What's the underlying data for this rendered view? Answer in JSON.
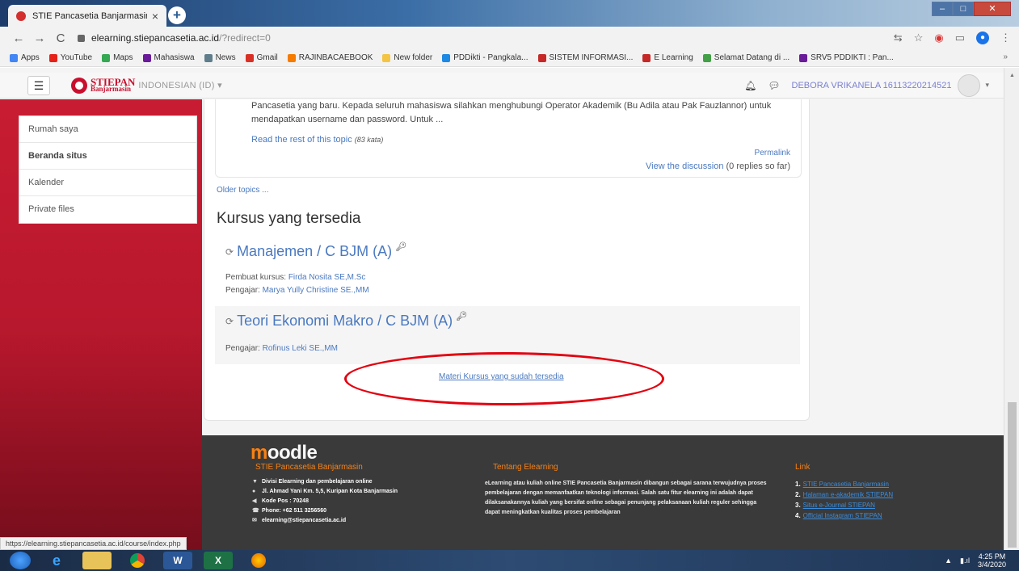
{
  "browser": {
    "tab_title": "STIE Pancasetia Banjarmasin",
    "tab_close": "×",
    "new_tab": "+",
    "url_host": "elearning.stiepancasetia.ac.id",
    "url_path": "/?redirect=0",
    "back": "←",
    "forward": "→",
    "reload": "C",
    "bookmarks": [
      {
        "label": "Apps",
        "color": "#4285f4"
      },
      {
        "label": "YouTube",
        "color": "#e62117"
      },
      {
        "label": "Maps",
        "color": "#34a853"
      },
      {
        "label": "Mahasiswa",
        "color": "#6a1b9a"
      },
      {
        "label": "News",
        "color": "#607d8b"
      },
      {
        "label": "Gmail",
        "color": "#d93025"
      },
      {
        "label": "RAJINBACAEBOOK",
        "color": "#f57c00"
      },
      {
        "label": "New folder",
        "color": "#f4c542"
      },
      {
        "label": "PDDikti - Pangkala...",
        "color": "#1e88e5"
      },
      {
        "label": "SISTEM INFORMASI...",
        "color": "#c62828"
      },
      {
        "label": "E Learning",
        "color": "#c62828"
      },
      {
        "label": "Selamat Datang di ...",
        "color": "#43a047"
      },
      {
        "label": "SRV5 PDDIKTI : Pan...",
        "color": "#6a1b9a"
      }
    ],
    "bookmarks_more": "»",
    "status_url": "https://elearning.stiepancasetia.ac.id/course/index.php"
  },
  "navbar": {
    "logo_line1": "STIEPAN",
    "logo_line2": "Banjarmasin",
    "language": "INDONESIAN (ID) ▾",
    "user_name": "DEBORA VRIKANELA 16113220214521",
    "caret": "▾"
  },
  "sidebar": {
    "items": [
      {
        "label": "Rumah saya",
        "bold": false
      },
      {
        "label": "Beranda situs",
        "bold": true
      },
      {
        "label": "Kalender",
        "bold": false
      },
      {
        "label": "Private files",
        "bold": false
      }
    ]
  },
  "forum": {
    "excerpt_line1": "Pancasetia yang baru. Kepada seluruh mahasiswa silahkan menghubungi Operator Akademik (Bu Adila atau Pak Fauzlannor) untuk",
    "excerpt_line2": "mendapatkan username dan password. Untuk ...",
    "read_more": "Read the rest of this topic",
    "word_count": "(83 kata)",
    "permalink": "Permalink",
    "view_discussion": "View the discussion",
    "replies": "(0 replies so far)",
    "older_topics": "Older topics ..."
  },
  "courses": {
    "heading": "Kursus yang tersedia",
    "list": [
      {
        "title": "Manajemen / C BJM (A)",
        "creator_label": "Pembuat kursus:",
        "creator": "Firda Nosita SE,M.Sc",
        "teacher_label": "Pengajar:",
        "teacher": "Marya Yully Christine SE.,MM"
      },
      {
        "title": "Teori Ekonomi Makro / C BJM (A)",
        "teacher_label": "Pengajar:",
        "teacher": "Rofinus Leki SE.,MM"
      }
    ],
    "all_courses_link": "Materi Kursus yang sudah tersedia"
  },
  "footer": {
    "logo": "moodle",
    "col1_title": "STIE Pancasetia Banjarmasin",
    "col1_lines": [
      "Divisi Elearning dan pembelajaran online",
      "Jl. Ahmad Yani Km. 5,5, Kuripan Kota Banjarmasin",
      "Kode Pos : 70248",
      "Phone: +62 511 3256560",
      "elearning@stiepancasetia.ac.id"
    ],
    "col2_title": "Tentang Elearning",
    "col2_text": "eLearning atau kuliah online STIE Pancasetia Banjarmasin dibangun sebagai sarana terwujudnya proses pembelajaran dengan memanfaatkan teknologi informasi. Salah satu fitur elearning ini adalah dapat dilaksanakannya kuliah yang bersifat online sebagai penunjang pelaksanaan kuliah reguler sehingga dapat meningkatkan kualitas proses pembelajaran",
    "col3_title": "Link",
    "links": [
      "STIE Pancasetia Banjarmasin",
      "Halaman e-akademik STIEPAN",
      "Situs e-Journal STIEPAN",
      "Official Instagram STIEPAN"
    ]
  },
  "taskbar": {
    "time": "4:25 PM",
    "date": "3/4/2020"
  }
}
